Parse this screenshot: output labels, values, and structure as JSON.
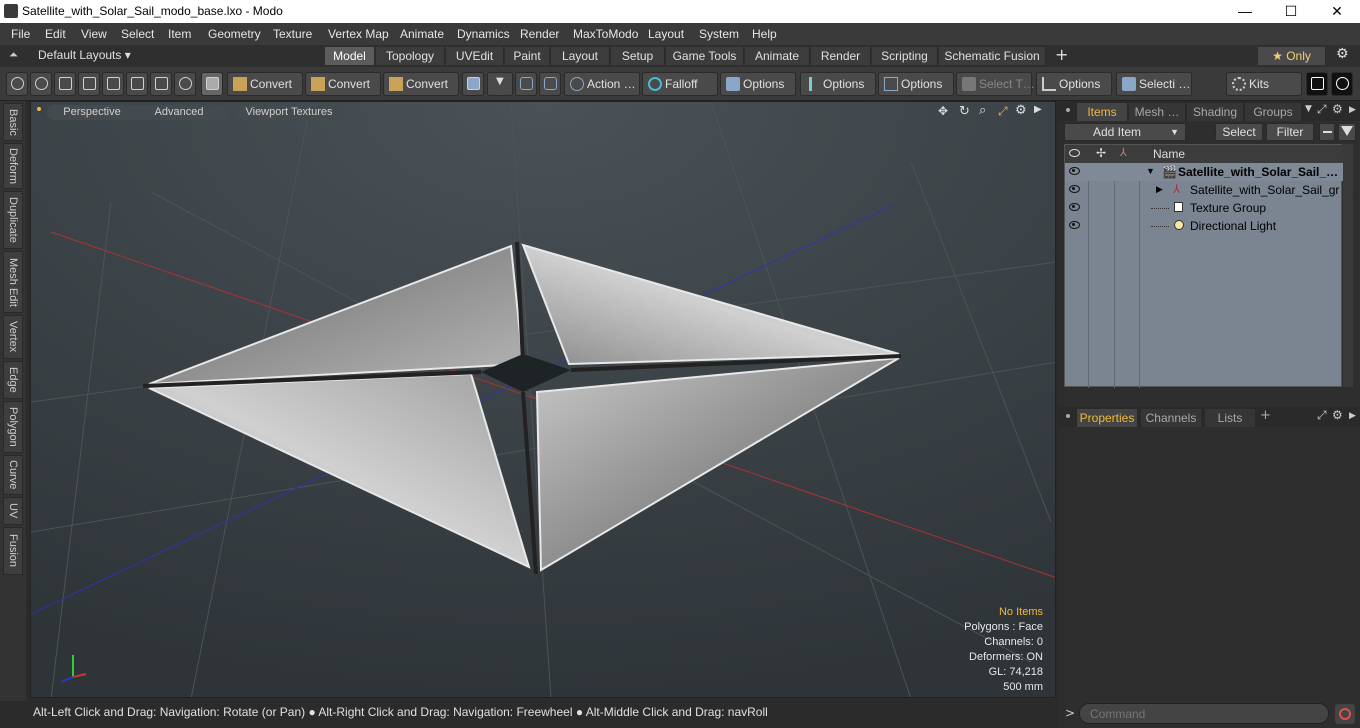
{
  "window": {
    "title": "Satellite_with_Solar_Sail_modo_base.lxo - Modo",
    "minimize": "—",
    "maximize": "☐",
    "close": "✕"
  },
  "menu": [
    "File",
    "Edit",
    "View",
    "Select",
    "Item",
    "Geometry",
    "Texture",
    "Vertex Map",
    "Animate",
    "Dynamics",
    "Render",
    "MaxToModo",
    "Layout",
    "System",
    "Help"
  ],
  "layoutbar": {
    "layouts_label": "Default Layouts ▾",
    "tabs": [
      "Model",
      "Topology",
      "UVEdit",
      "Paint",
      "Layout",
      "Setup",
      "Game Tools",
      "Animate",
      "Render",
      "Scripting",
      "Schematic Fusion"
    ],
    "active_tab": "Model",
    "add": "+",
    "only_label": "★  Only",
    "gear": "⚙"
  },
  "toolbar": {
    "convert1": "Convert",
    "convert2": "Convert",
    "convert3": "Convert",
    "action": "Action  …",
    "falloff": "Falloff",
    "options1": "Options",
    "options2": "Options",
    "options3": "Options",
    "select_t": "Select T…",
    "options4": "Options",
    "selecti": "Selecti …",
    "kits": "Kits"
  },
  "sidetabs": [
    "Basic",
    "Deform",
    "Duplicate",
    "Mesh Edit",
    "Vertex",
    "Edge",
    "Polygon",
    "Curve",
    "UV",
    "Fusion"
  ],
  "viewport": {
    "perspective": "Perspective",
    "advanced": "Advanced",
    "textures": "Viewport Textures",
    "stats": {
      "no_items": "No Items",
      "polygons": "Polygons : Face",
      "channels": "Channels: 0",
      "deformers": "Deformers: ON",
      "gl": "GL: 74,218",
      "size": "500 mm"
    }
  },
  "statusbar": {
    "text": "Alt-Left Click and Drag: Navigation: Rotate (or Pan) ● Alt-Right Click and Drag: Navigation: Freewheel ● Alt-Middle Click and Drag: navRoll"
  },
  "items_panel": {
    "tabs": [
      "Items",
      "Mesh …",
      "Shading",
      "Groups"
    ],
    "active_tab": "Items",
    "add_item": "Add Item",
    "select": "Select",
    "filter": "Filter",
    "col_name": "Name",
    "rows": [
      {
        "name": "Satellite_with_Solar_Sail_…",
        "bold": true
      },
      {
        "name": "Satellite_with_Solar_Sail_gr …",
        "bold": false
      },
      {
        "name": "Texture Group",
        "bold": false
      },
      {
        "name": "Directional Light",
        "bold": false
      }
    ]
  },
  "props_panel": {
    "tabs": [
      "Properties",
      "Channels",
      "Lists"
    ],
    "active_tab": "Properties",
    "add": "+"
  },
  "command": {
    "placeholder": "Command",
    "prompt": ">"
  }
}
